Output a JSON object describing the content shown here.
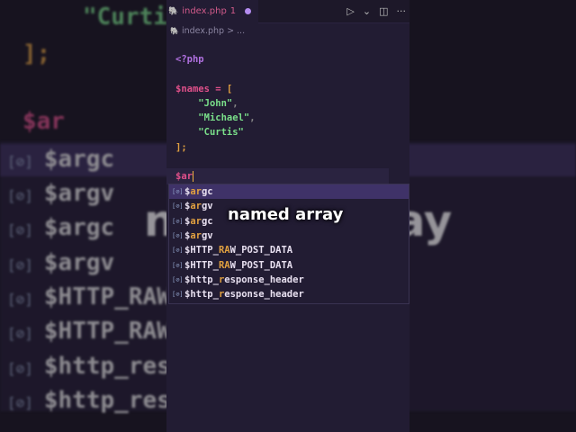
{
  "tab": {
    "filename": "index.php",
    "problems": "1"
  },
  "breadcrumb": {
    "file": "index.php",
    "sep": ">",
    "more": "..."
  },
  "code": {
    "open": "<?php",
    "var": "$names",
    "eq": "=",
    "lb": "[",
    "items": [
      "\"John\"",
      "\"Michael\"",
      "\"Curtis\""
    ],
    "comma": ",",
    "close": "];",
    "typed": "$ar"
  },
  "suggestions": [
    {
      "pre": "$",
      "hl": "ar",
      "post": "gc"
    },
    {
      "pre": "$",
      "hl": "ar",
      "post": "gv"
    },
    {
      "pre": "$",
      "hl": "ar",
      "post": "gc"
    },
    {
      "pre": "$",
      "hl": "ar",
      "post": "gv"
    },
    {
      "pre": "$HTTP_",
      "hl": "RA",
      "post": "W_POST_DATA"
    },
    {
      "pre": "$HTTP_",
      "hl": "RA",
      "post": "W_POST_DATA"
    },
    {
      "pre": "$http_",
      "hl": "r",
      "post": "esponse_header"
    },
    {
      "pre": "$http_",
      "hl": "r",
      "post": "esponse_header"
    }
  ],
  "caption": "named array",
  "icons": {
    "suggestion": "[⊘]",
    "run": "▷",
    "chevron": "⌄",
    "split": "◫",
    "more": "···",
    "php": "🐘"
  }
}
